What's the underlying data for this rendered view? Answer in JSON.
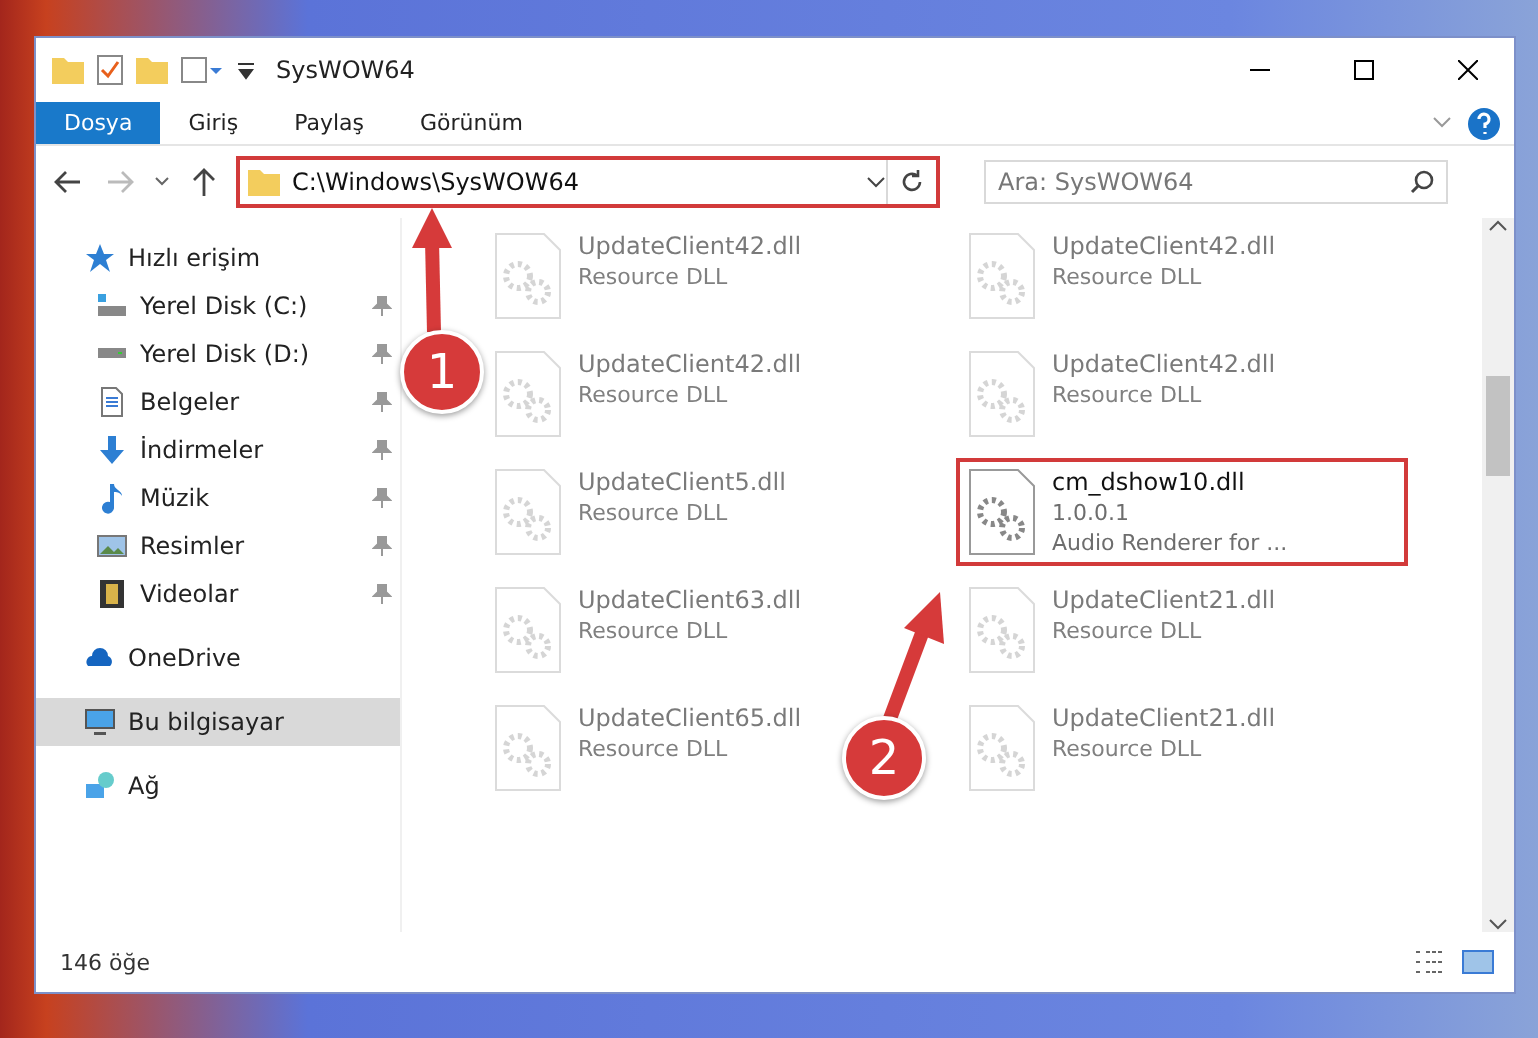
{
  "window": {
    "title": "SysWOW64"
  },
  "ribbon_tabs": [
    {
      "label": "Dosya",
      "selected": true
    },
    {
      "label": "Giriş",
      "selected": false
    },
    {
      "label": "Paylaş",
      "selected": false
    },
    {
      "label": "Görünüm",
      "selected": false
    }
  ],
  "address": {
    "value": "C:\\Windows\\SysWOW64",
    "highlighted": true
  },
  "search": {
    "placeholder": "Ara: SysWOW64"
  },
  "sidebar": {
    "items": [
      {
        "label": "Hızlı erişim",
        "kind": "star",
        "selected": false,
        "children": [
          {
            "label": "Yerel Disk (C:)",
            "kind": "system",
            "pinned": true,
            "selected": false
          },
          {
            "label": "Yerel Disk (D:)",
            "kind": "drive",
            "pinned": true,
            "selected": false
          },
          {
            "label": "Belgeler",
            "kind": "doc",
            "pinned": true,
            "selected": false
          },
          {
            "label": "İndirmeler",
            "kind": "download",
            "pinned": true,
            "selected": false
          },
          {
            "label": "Müzik",
            "kind": "music",
            "pinned": true,
            "selected": false
          },
          {
            "label": "Resimler",
            "kind": "pictures",
            "pinned": true,
            "selected": false
          },
          {
            "label": "Videolar",
            "kind": "videos",
            "pinned": true,
            "selected": false
          }
        ]
      },
      {
        "label": "OneDrive",
        "kind": "cloud",
        "selected": false
      },
      {
        "label": "Bu bilgisayar",
        "kind": "computer",
        "selected": true
      },
      {
        "label": "Ağ",
        "kind": "network",
        "selected": false
      }
    ]
  },
  "files": [
    {
      "name": "UpdateClient42.dll",
      "lines": [
        "Resource DLL"
      ],
      "faded": true,
      "highlighted": false
    },
    {
      "name": "UpdateClient42.dll",
      "lines": [
        "Resource DLL"
      ],
      "faded": true,
      "highlighted": false
    },
    {
      "name": "UpdateClient42.dll",
      "lines": [
        "Resource DLL"
      ],
      "faded": true,
      "highlighted": false
    },
    {
      "name": "UpdateClient42.dll",
      "lines": [
        "Resource DLL"
      ],
      "faded": true,
      "highlighted": false
    },
    {
      "name": "UpdateClient5.dll",
      "lines": [
        "Resource DLL"
      ],
      "faded": true,
      "highlighted": false
    },
    {
      "name": "cm_dshow10.dll",
      "lines": [
        "1.0.0.1",
        "Audio Renderer for ..."
      ],
      "faded": false,
      "highlighted": true
    },
    {
      "name": "UpdateClient63.dll",
      "lines": [
        "Resource DLL"
      ],
      "faded": true,
      "highlighted": false
    },
    {
      "name": "UpdateClient21.dll",
      "lines": [
        "Resource DLL"
      ],
      "faded": true,
      "highlighted": false
    },
    {
      "name": "UpdateClient65.dll",
      "lines": [
        "Resource DLL"
      ],
      "faded": true,
      "highlighted": false
    },
    {
      "name": "UpdateClient21.dll",
      "lines": [
        "Resource DLL"
      ],
      "faded": true,
      "highlighted": false
    }
  ],
  "status_bar": {
    "count": "146 öğe"
  },
  "annotations": [
    {
      "number": "1"
    },
    {
      "number": "2"
    }
  ]
}
